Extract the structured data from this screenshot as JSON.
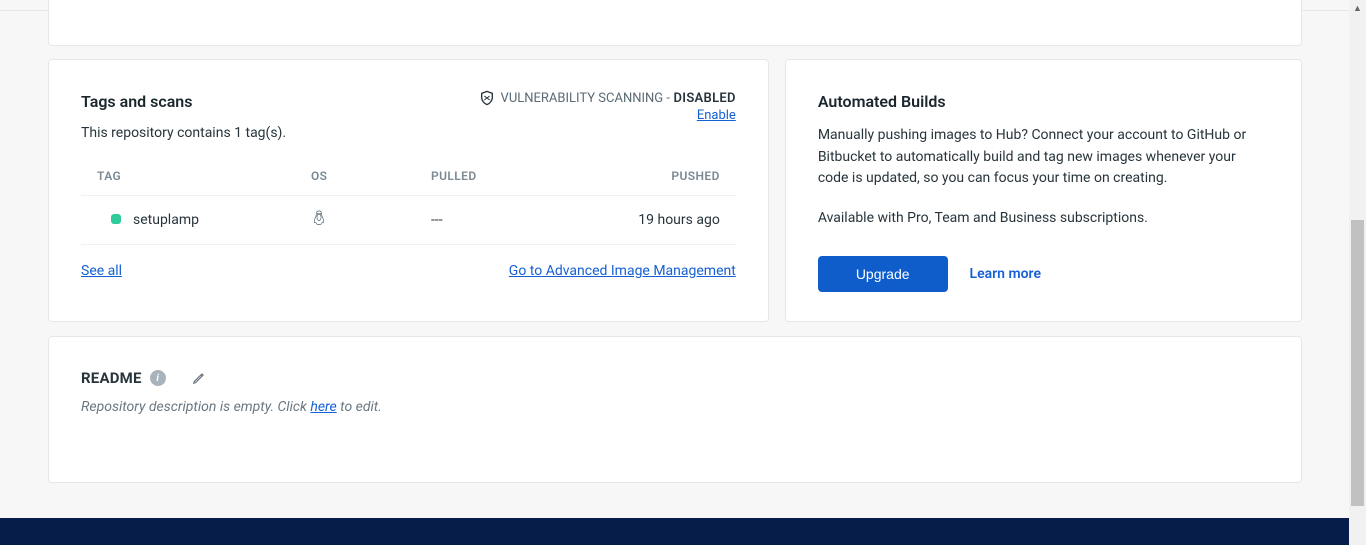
{
  "tags_card": {
    "title": "Tags and scans",
    "subtext": "This repository contains 1 tag(s).",
    "vuln_label": "VULNERABILITY SCANNING -",
    "vuln_status": " DISABLED",
    "enable_link": "Enable",
    "headers": {
      "tag": "TAG",
      "os": "OS",
      "pulled": "PULLED",
      "pushed": "PUSHED"
    },
    "row": {
      "name": "setuplamp",
      "pulled": "---",
      "pushed": "19 hours ago"
    },
    "see_all": "See all",
    "advanced_link": "Go to Advanced Image Management"
  },
  "builds_card": {
    "title": "Automated Builds",
    "p1": "Manually pushing images to Hub? Connect your account to GitHub or Bitbucket to automatically build and tag new images whenever your code is updated, so you can focus your time on creating.",
    "p2": "Available with Pro, Team and Business subscriptions.",
    "upgrade": "Upgrade",
    "learn": "Learn more"
  },
  "readme": {
    "title": "README",
    "desc_prefix": "Repository description is empty. Click ",
    "desc_link": "here",
    "desc_suffix": " to edit."
  }
}
